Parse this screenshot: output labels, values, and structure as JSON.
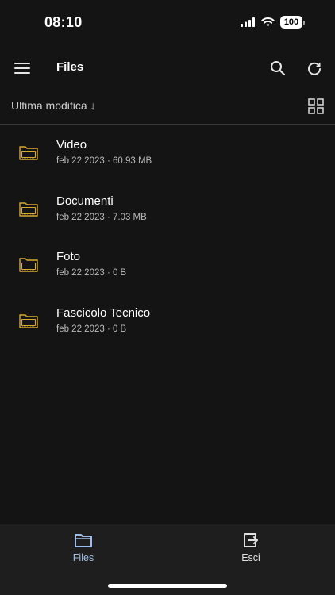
{
  "status_bar": {
    "time": "08:10",
    "battery": "100"
  },
  "app_bar": {
    "title": "Files"
  },
  "sort": {
    "label": "Ultima modifica",
    "arrow": "↓"
  },
  "files": [
    {
      "name": "Video",
      "meta": "feb 22 2023 · 60.93 MB",
      "icon": "folder-icon"
    },
    {
      "name": "Documenti",
      "meta": "feb 22 2023 · 7.03 MB",
      "icon": "folder-icon"
    },
    {
      "name": "Foto",
      "meta": "feb 22 2023 · 0 B",
      "icon": "folder-icon"
    },
    {
      "name": "Fascicolo Tecnico",
      "meta": "feb 22 2023 · 0 B",
      "icon": "folder-icon"
    }
  ],
  "bottom_nav": {
    "files_label": "Files",
    "esci_label": "Esci"
  },
  "colors": {
    "background": "#141414",
    "folder_accent": "#d9a92f",
    "active_nav": "#9fbde6",
    "nav_background": "#1e1e1e"
  }
}
